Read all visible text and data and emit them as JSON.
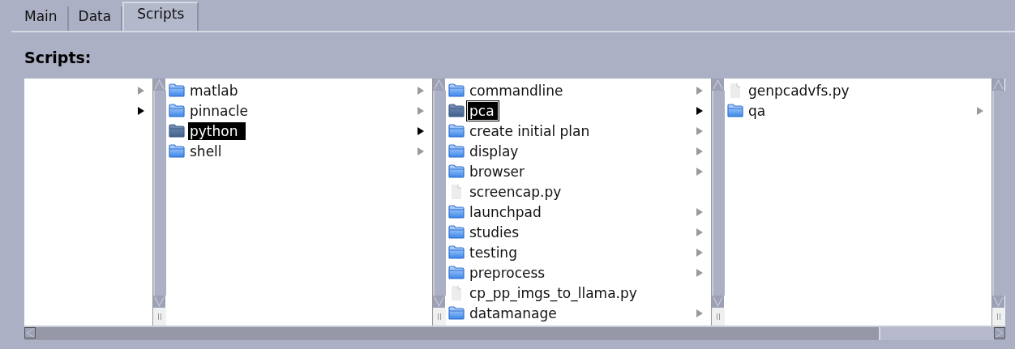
{
  "tabs": [
    {
      "label": "Main",
      "selected": false
    },
    {
      "label": "Data",
      "selected": false
    },
    {
      "label": "Scripts",
      "selected": true
    }
  ],
  "section_label": "Scripts:",
  "columns": [
    {
      "items": [
        {
          "has_children": true,
          "selected": false
        },
        {
          "has_children": true,
          "selected": true
        }
      ]
    },
    {
      "items": [
        {
          "kind": "folder",
          "label": "matlab",
          "has_children": true,
          "selected": false,
          "focused": false
        },
        {
          "kind": "folder",
          "label": "pinnacle",
          "has_children": true,
          "selected": false,
          "focused": false
        },
        {
          "kind": "folder",
          "label": "python",
          "has_children": true,
          "selected": true,
          "focused": false
        },
        {
          "kind": "folder",
          "label": "shell",
          "has_children": true,
          "selected": false,
          "focused": false
        }
      ]
    },
    {
      "items": [
        {
          "kind": "folder",
          "label": "commandline",
          "has_children": true,
          "selected": false,
          "focused": false
        },
        {
          "kind": "folder",
          "label": "pca",
          "has_children": true,
          "selected": true,
          "focused": true
        },
        {
          "kind": "folder",
          "label": "create initial plan",
          "has_children": true,
          "selected": false,
          "focused": false
        },
        {
          "kind": "folder",
          "label": "display",
          "has_children": true,
          "selected": false,
          "focused": false
        },
        {
          "kind": "folder",
          "label": "browser",
          "has_children": true,
          "selected": false,
          "focused": false
        },
        {
          "kind": "file",
          "label": "screencap.py",
          "has_children": false,
          "selected": false,
          "focused": false
        },
        {
          "kind": "folder",
          "label": "launchpad",
          "has_children": true,
          "selected": false,
          "focused": false
        },
        {
          "kind": "folder",
          "label": "studies",
          "has_children": true,
          "selected": false,
          "focused": false
        },
        {
          "kind": "folder",
          "label": "testing",
          "has_children": true,
          "selected": false,
          "focused": false
        },
        {
          "kind": "folder",
          "label": "preprocess",
          "has_children": true,
          "selected": false,
          "focused": false
        },
        {
          "kind": "file",
          "label": "cp_pp_imgs_to_llama.py",
          "has_children": false,
          "selected": false,
          "focused": false
        },
        {
          "kind": "folder",
          "label": "datamanage",
          "has_children": true,
          "selected": false,
          "focused": false
        }
      ]
    },
    {
      "items": [
        {
          "kind": "file",
          "label": "genpcadvfs.py",
          "has_children": false,
          "selected": false,
          "focused": false
        },
        {
          "kind": "folder",
          "label": "qa",
          "has_children": true,
          "selected": false,
          "focused": false
        }
      ]
    }
  ]
}
